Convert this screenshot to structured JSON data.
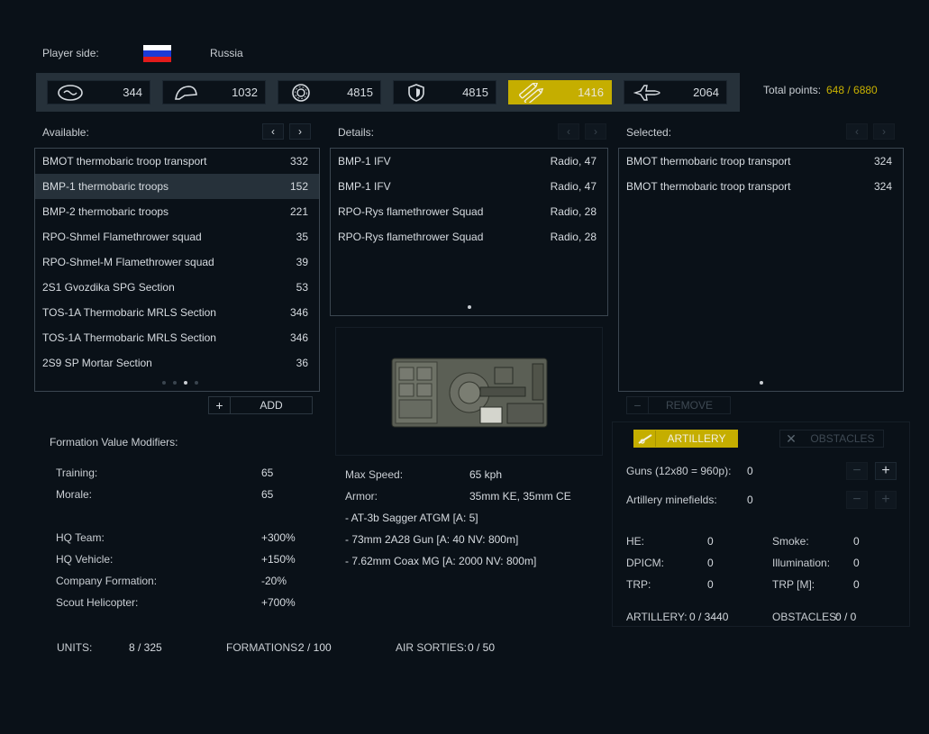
{
  "header": {
    "player_side_label": "Player side:",
    "country": "Russia",
    "total_points_label": "Total points:",
    "total_points_value": "648 / 6880"
  },
  "points": [
    {
      "icon": "recon-icon",
      "value": "344"
    },
    {
      "icon": "infantry-helmet-icon",
      "value": "1032"
    },
    {
      "icon": "vehicle-wheel-icon",
      "value": "4815"
    },
    {
      "icon": "shield-icon",
      "value": "4815"
    },
    {
      "icon": "ammo-shells-icon",
      "value": "1416",
      "active": true
    },
    {
      "icon": "jet-aircraft-icon",
      "value": "2064"
    }
  ],
  "available": {
    "title": "Available:",
    "items": [
      {
        "name": "BMOT thermobaric troop transport",
        "cost": "332"
      },
      {
        "name": "BMP-1 thermobaric troops",
        "cost": "152",
        "selected": true
      },
      {
        "name": "BMP-2 thermobaric troops",
        "cost": "221"
      },
      {
        "name": "RPO-Shmel Flamethrower squad",
        "cost": "35"
      },
      {
        "name": "RPO-Shmel-M Flamethrower squad",
        "cost": "39"
      },
      {
        "name": "2S1 Gvozdika SPG Section",
        "cost": "53"
      },
      {
        "name": "TOS-1A Thermobaric MRLS Section",
        "cost": "346"
      },
      {
        "name": "TOS-1A Thermobaric MRLS Section",
        "cost": "346"
      },
      {
        "name": "2S9 SP Mortar Section",
        "cost": "36"
      }
    ],
    "add_label": "ADD",
    "prev": "‹",
    "next": "›"
  },
  "details": {
    "title": "Details:",
    "items": [
      {
        "name": "BMP-1 IFV",
        "info": "Radio, 47"
      },
      {
        "name": "BMP-1 IFV",
        "info": "Radio, 47"
      },
      {
        "name": "RPO-Rys flamethrower Squad",
        "info": "Radio, 28"
      },
      {
        "name": "RPO-Rys flamethrower Squad",
        "info": "Radio, 28"
      }
    ],
    "stats": {
      "max_speed_label": "Max Speed:",
      "max_speed": "65 kph",
      "armor_label": "Armor:",
      "armor": "35mm KE, 35mm CE",
      "weapons": [
        "- AT-3b Sagger ATGM [A: 5]",
        "- 73mm 2A28 Gun [A: 40 NV: 800m]",
        "- 7.62mm Coax MG [A: 2000 NV: 800m]"
      ]
    }
  },
  "selected": {
    "title": "Selected:",
    "items": [
      {
        "name": "BMOT thermobaric troop transport",
        "cost": "324"
      },
      {
        "name": "BMOT thermobaric troop transport",
        "cost": "324"
      }
    ],
    "remove_label": "REMOVE"
  },
  "modifiers": {
    "title": "Formation Value Modifiers:",
    "rows": [
      {
        "label": "Training:",
        "value": "65"
      },
      {
        "label": "Morale:",
        "value": "65"
      },
      {
        "label": "HQ Team:",
        "value": "+300%"
      },
      {
        "label": "HQ Vehicle:",
        "value": "+150%"
      },
      {
        "label": "Company Formation:",
        "value": "-20%"
      },
      {
        "label": "Scout Helicopter:",
        "value": "+700%"
      }
    ]
  },
  "footer": {
    "units_label": "UNITS:",
    "units": "8 / 325",
    "formations_label": "FORMATIONS:",
    "formations": "2 / 100",
    "air_label": "AIR SORTIES:",
    "air": "0 / 50"
  },
  "support": {
    "artillery_tab": "ARTILLERY",
    "obstacles_tab": "OBSTACLES",
    "guns_label": "Guns (12x80 = 960p):",
    "guns_value": "0",
    "minefields_label": "Artillery minefields:",
    "minefields_value": "0",
    "he_label": "HE:",
    "he": "0",
    "smoke_label": "Smoke:",
    "smoke": "0",
    "dpicm_label": "DPICM:",
    "dpicm": "0",
    "illum_label": "Illumination:",
    "illum": "0",
    "trp_label": "TRP:",
    "trp": "0",
    "trpm_label": "TRP [M]:",
    "trpm": "0",
    "artillery_total_label": "ARTILLERY:",
    "artillery_total": "0 / 3440",
    "obstacles_total_label": "OBSTACLES:",
    "obstacles_total": "0 / 0",
    "plus": "+",
    "minus": "−"
  }
}
